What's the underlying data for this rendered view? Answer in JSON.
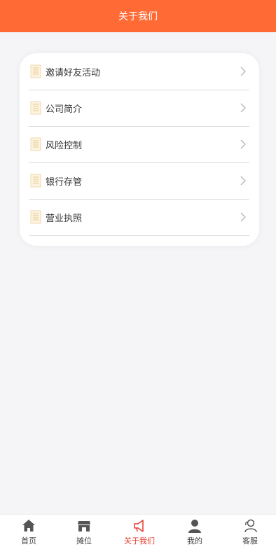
{
  "header": {
    "title": "关于我们"
  },
  "menu": {
    "items": [
      {
        "label": "邀请好友活动"
      },
      {
        "label": "公司简介"
      },
      {
        "label": "风险控制"
      },
      {
        "label": "银行存管"
      },
      {
        "label": "营业执照"
      }
    ]
  },
  "tabbar": {
    "tabs": [
      {
        "label": "首页",
        "icon": "home-icon"
      },
      {
        "label": "摊位",
        "icon": "store-icon"
      },
      {
        "label": "关于我们",
        "icon": "megaphone-icon",
        "active": true
      },
      {
        "label": "我的",
        "icon": "user-icon"
      },
      {
        "label": "客服",
        "icon": "customer-service-icon"
      }
    ]
  },
  "colors": {
    "header": "#ff6a35",
    "active_tab": "#e53a2f",
    "background": "#f5f4f7"
  }
}
